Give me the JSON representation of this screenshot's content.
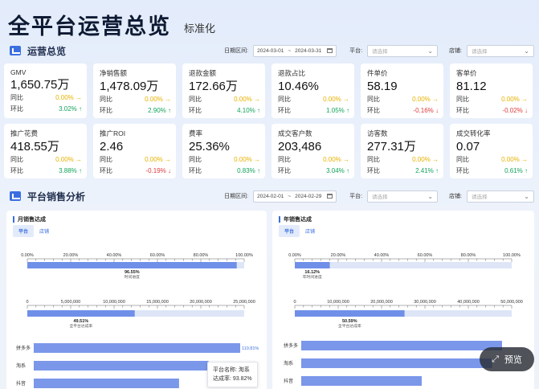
{
  "header": {
    "title": "全平台运营总览",
    "subtitle": "标准化"
  },
  "overview": {
    "label": "运营总览",
    "filters": {
      "date_label": "日期区间:",
      "date_start": "2024-03-01",
      "date_sep": "~",
      "date_end": "2024-03-31",
      "platform_label": "平台:",
      "platform_placeholder": "请选择",
      "shop_label": "店铺:",
      "shop_placeholder": "请选择"
    },
    "yoy_label": "同比",
    "mom_label": "环比",
    "cards": [
      {
        "name": "GMV",
        "value": "1,650.75万",
        "yoy": "0.00%",
        "yoy_arrow": "→",
        "mom": "3.02%",
        "mom_arrow": "↑",
        "yoy_trend": "neutral",
        "mom_trend": "up"
      },
      {
        "name": "净销售额",
        "value": "1,478.09万",
        "yoy": "0.00%",
        "yoy_arrow": "→",
        "mom": "2.90%",
        "mom_arrow": "↑",
        "yoy_trend": "neutral",
        "mom_trend": "up"
      },
      {
        "name": "退款金额",
        "value": "172.66万",
        "yoy": "0.00%",
        "yoy_arrow": "→",
        "mom": "4.10%",
        "mom_arrow": "↑",
        "yoy_trend": "neutral",
        "mom_trend": "up"
      },
      {
        "name": "退款占比",
        "value": "10.46%",
        "yoy": "0.00%",
        "yoy_arrow": "→",
        "mom": "1.05%",
        "mom_arrow": "↑",
        "yoy_trend": "neutral",
        "mom_trend": "up"
      },
      {
        "name": "件单价",
        "value": "58.19",
        "yoy": "0.00%",
        "yoy_arrow": "→",
        "mom": "-0.16%",
        "mom_arrow": "↓",
        "yoy_trend": "neutral",
        "mom_trend": "down"
      },
      {
        "name": "客单价",
        "value": "81.12",
        "yoy": "0.00%",
        "yoy_arrow": "→",
        "mom": "-0.02%",
        "mom_arrow": "↓",
        "yoy_trend": "neutral",
        "mom_trend": "down"
      },
      {
        "name": "推广花费",
        "value": "418.55万",
        "yoy": "0.00%",
        "yoy_arrow": "→",
        "mom": "3.88%",
        "mom_arrow": "↑",
        "yoy_trend": "neutral",
        "mom_trend": "up"
      },
      {
        "name": "推广ROI",
        "value": "2.46",
        "yoy": "0.00%",
        "yoy_arrow": "→",
        "mom": "-0.19%",
        "mom_arrow": "↓",
        "yoy_trend": "neutral",
        "mom_trend": "down"
      },
      {
        "name": "费率",
        "value": "25.36%",
        "yoy": "0.00%",
        "yoy_arrow": "→",
        "mom": "0.83%",
        "mom_arrow": "↑",
        "yoy_trend": "neutral",
        "mom_trend": "up"
      },
      {
        "name": "成交客户数",
        "value": "203,486",
        "yoy": "0.00%",
        "yoy_arrow": "→",
        "mom": "3.04%",
        "mom_arrow": "↑",
        "yoy_trend": "neutral",
        "mom_trend": "up"
      },
      {
        "name": "访客数",
        "value": "277.31万",
        "yoy": "0.00%",
        "yoy_arrow": "→",
        "mom": "2.41%",
        "mom_arrow": "↑",
        "yoy_trend": "neutral",
        "mom_trend": "up"
      },
      {
        "name": "成交转化率",
        "value": "0.07",
        "yoy": "0.00%",
        "yoy_arrow": "→",
        "mom": "0.61%",
        "mom_arrow": "↑",
        "yoy_trend": "neutral",
        "mom_trend": "up"
      }
    ]
  },
  "sales": {
    "label": "平台销售分析",
    "filters": {
      "date_label": "日期区间:",
      "date_start": "2024-02-01",
      "date_sep": "~",
      "date_end": "2024-02-29",
      "platform_label": "平台:",
      "platform_placeholder": "请选择",
      "shop_label": "店铺:",
      "shop_placeholder": "请选择"
    },
    "monthly": {
      "title": "月销售达成",
      "tabs": [
        "平台",
        "店铺"
      ],
      "tooltip": {
        "line1": "平台名称: 淘系",
        "line2": "达成率: 93.82%"
      }
    },
    "yearly": {
      "title": "年销售达成",
      "tabs": [
        "平台",
        "店铺"
      ]
    }
  },
  "preview_button": "预览",
  "colors": {
    "accent": "#3b6fe0",
    "bar": "#6f8fe8",
    "bar_light": "#c7d3f3",
    "up": "#12a35a",
    "down": "#e13a3a",
    "neutral": "#e8b100"
  },
  "chart_data": [
    {
      "type": "bar",
      "title": "",
      "xlabel": "时间进度",
      "categories": [
        "时间进度"
      ],
      "values": [
        96.55
      ],
      "ylim": [
        0,
        100
      ],
      "ticks": [
        "0.00%",
        "20.00%",
        "40.00%",
        "60.00%",
        "80.00%",
        "100.00%"
      ],
      "data_label": "96.55%"
    },
    {
      "type": "bar",
      "title": "",
      "xlabel": "全平台达成率",
      "categories": [
        "全平台达成率"
      ],
      "values": [
        49.51
      ],
      "ylim": [
        0,
        25000000
      ],
      "ticks": [
        "0",
        "5,000,000",
        "10,000,000",
        "15,000,000",
        "20,000,000",
        "25,000,000"
      ],
      "data_label": "49.51%"
    },
    {
      "type": "bar",
      "title": "",
      "categories": [
        "拼多多",
        "淘系",
        "抖音"
      ],
      "values": [
        110.81,
        93.82,
        78.0
      ],
      "ylim": [
        0,
        110.81
      ],
      "data_label": "110.81%"
    },
    {
      "type": "bar",
      "title": "",
      "xlabel": "年时间进度",
      "categories": [
        "年时间进度"
      ],
      "values": [
        16.12
      ],
      "ylim": [
        0,
        100
      ],
      "ticks": [
        "0.00%",
        "20.00%",
        "40.00%",
        "60.00%",
        "80.00%",
        "100.00%"
      ],
      "data_label": "16.12%"
    },
    {
      "type": "bar",
      "title": "",
      "xlabel": "全平台达成率",
      "categories": [
        "全平台达成率"
      ],
      "values": [
        50.59
      ],
      "ylim": [
        0,
        60000000
      ],
      "ticks": [
        "0",
        "10,000,000",
        "20,000,000",
        "30,000,000",
        "40,000,000",
        "50,000,000"
      ],
      "data_label": "50.59%"
    },
    {
      "type": "bar",
      "title": "",
      "categories": [
        "拼多多",
        "淘系",
        "抖音"
      ],
      "values": [
        100,
        95,
        60
      ],
      "ylim": [
        0,
        100
      ]
    }
  ]
}
